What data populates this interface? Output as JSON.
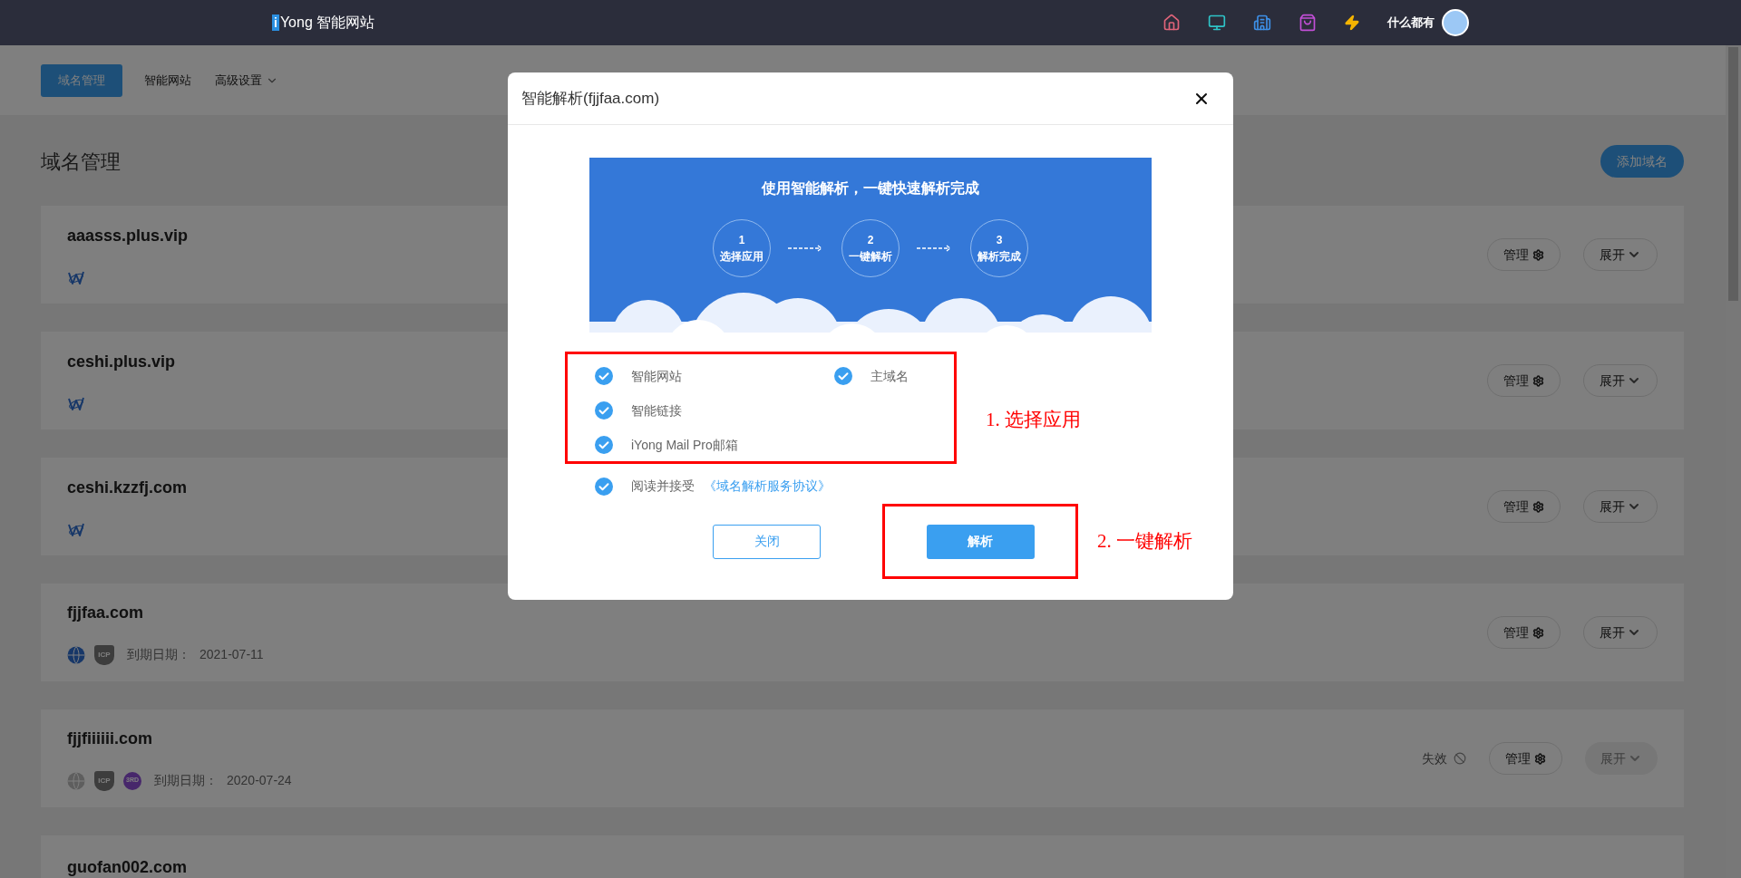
{
  "topbar": {
    "logo_mark": "i",
    "logo_text": "Yong 智能网站",
    "user_name": "什么都有"
  },
  "subnav": [
    {
      "label": "域名管理",
      "selected": true,
      "has_menu": false
    },
    {
      "label": "智能网站",
      "selected": false,
      "has_menu": false
    },
    {
      "label": "高级设置",
      "selected": false,
      "has_menu": true
    }
  ],
  "page_title": "域名管理",
  "add_button": "添加域名",
  "domains": [
    {
      "name": "aaasss.plus.vip",
      "kind": "site",
      "manage": "管理",
      "expand": "展开",
      "expand_disabled": false
    },
    {
      "name": "ceshi.plus.vip",
      "kind": "site",
      "manage": "管理",
      "expand": "展开",
      "expand_disabled": false
    },
    {
      "name": "ceshi.kzzfj.com",
      "kind": "site",
      "manage": "管理",
      "expand": "展开",
      "expand_disabled": false
    },
    {
      "name": "fjjfaa.com",
      "kind": "registered",
      "dns_active": true,
      "icp": "ICP",
      "expiry_label": "到期日期：",
      "expiry": "2021-07-11",
      "manage": "管理",
      "expand": "展开",
      "expand_disabled": false
    },
    {
      "name": "fjjfiiiiii.com",
      "kind": "registered",
      "dns_active": false,
      "icp": "ICP",
      "third_party": "3RD",
      "expiry_label": "到期日期：",
      "expiry": "2020-07-24",
      "status": "失效",
      "manage": "管理",
      "expand": "展开",
      "expand_disabled": true
    },
    {
      "name": "guofan002.com",
      "kind": "cut"
    }
  ],
  "dialog": {
    "title": "智能解析(fjjfaa.com)",
    "banner": {
      "headline": "使用智能解析，一键快速解析完成",
      "steps": [
        {
          "number": "1",
          "label": "选择应用"
        },
        {
          "number": "2",
          "label": "一键解析"
        },
        {
          "number": "3",
          "label": "解析完成"
        }
      ]
    },
    "apps_left": [
      {
        "label": "智能网站",
        "checked": true
      },
      {
        "label": "智能链接",
        "checked": true
      },
      {
        "label": "iYong Mail Pro邮箱",
        "checked": true
      }
    ],
    "apps_right": [
      {
        "label": "主域名",
        "checked": true
      }
    ],
    "agreement": {
      "checked": true,
      "text": "阅读并接受",
      "link": "《域名解析服务协议》"
    },
    "close_button": "关闭",
    "confirm_button": "解析"
  },
  "annotations": [
    {
      "text": "1. 选择应用"
    },
    {
      "text": "2. 一键解析"
    }
  ]
}
